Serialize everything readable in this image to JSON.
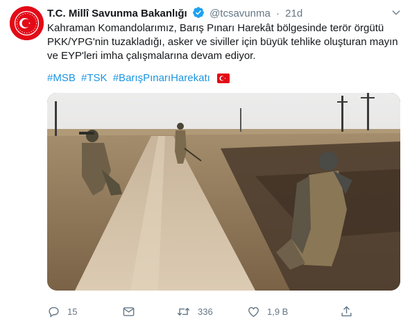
{
  "account": {
    "name": "T.C. Millî Savunma Bakanlığı",
    "handle": "@tcsavunma",
    "separator": "·",
    "time": "21d",
    "verified": true
  },
  "tweet": {
    "text": "Kahraman Komandolarımız, Barış Pınarı Harekât bölgesinde terör örgütü\nPKK/YPG'nin tuzakladığı, asker ve siviller için büyük tehlike oluşturan mayın\nve EYP'leri imha çalışmalarına devam ediyor.",
    "hashtags": [
      "#MSB",
      "#TSK",
      "#BarışPınarıHarekatı"
    ],
    "flag_emoji": "turkey-flag"
  },
  "media": {
    "type": "video-still",
    "description_icon": "soldiers-on-dirt-road"
  },
  "actions": {
    "reply_count": "15",
    "retweet_count": "336",
    "like_count": "1,9 B"
  },
  "colors": {
    "text": "#14171a",
    "secondary": "#657786",
    "link": "#1b95e0",
    "verified": "#1da1f2",
    "avatar_red": "#e30a17"
  }
}
